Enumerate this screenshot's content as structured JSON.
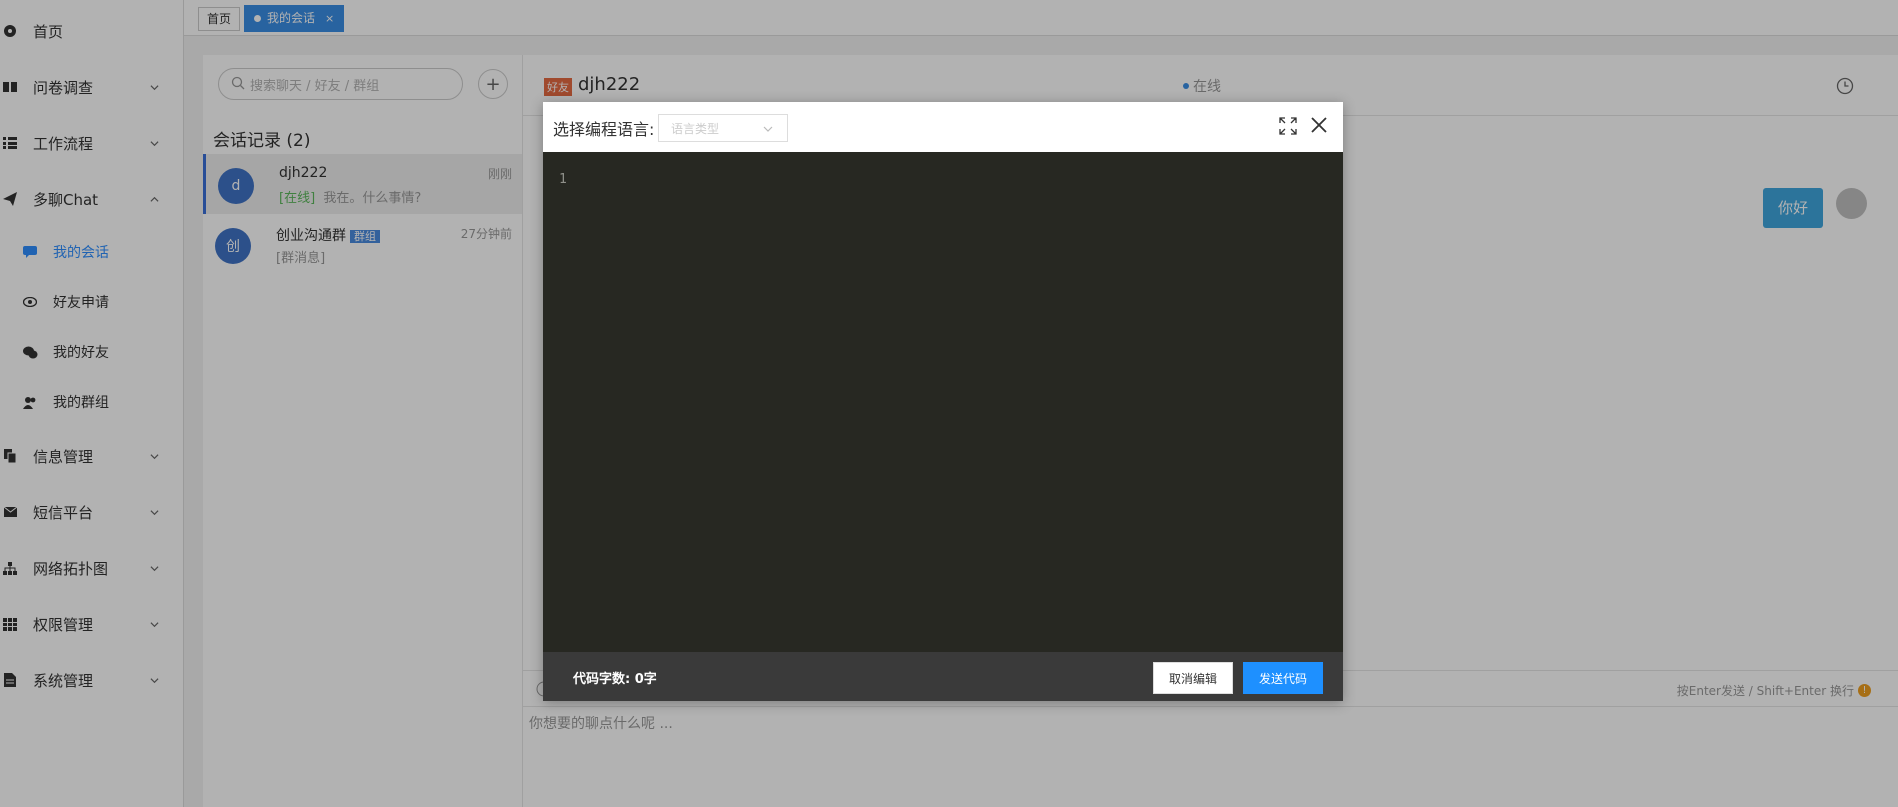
{
  "sidebar": {
    "menu": [
      {
        "label": "首页",
        "icon": "dashboard-icon"
      },
      {
        "label": "问卷调查",
        "icon": "book-icon"
      },
      {
        "label": "工作流程",
        "icon": "list-icon"
      },
      {
        "label": "多聊Chat",
        "icon": "paper-plane-icon"
      },
      {
        "label": "信息管理",
        "icon": "copy-icon"
      },
      {
        "label": "短信平台",
        "icon": "envelope-icon"
      },
      {
        "label": "网络拓扑图",
        "icon": "sitemap-icon"
      },
      {
        "label": "权限管理",
        "icon": "grid-icon"
      },
      {
        "label": "系统管理",
        "icon": "file-icon"
      }
    ],
    "chat_sub": [
      {
        "label": "我的会话",
        "icon": "comment-icon"
      },
      {
        "label": "好友申请",
        "icon": "eye-icon"
      },
      {
        "label": "我的好友",
        "icon": "wechat-icon"
      },
      {
        "label": "我的群组",
        "icon": "users-icon"
      }
    ]
  },
  "tabs": {
    "home": "首页",
    "active": "我的会话",
    "close": "×"
  },
  "conversations": {
    "search_placeholder": "搜索聊天 / 好友 / 群组",
    "add": "+",
    "title": "会话记录 (2)",
    "items": [
      {
        "avatar": "d",
        "name": "djh222",
        "status": "[在线]",
        "preview": "我在。什么事情?",
        "time": "刚刚"
      },
      {
        "avatar": "创",
        "name": "创业沟通群",
        "badge": "群组",
        "preview": "[群消息]",
        "time": "27分钟前"
      }
    ]
  },
  "chat": {
    "badge": "好友",
    "name": "djh222",
    "status": "在线",
    "message": "你好",
    "hint": "按Enter发送 / Shift+Enter 换行",
    "hint_icon": "!",
    "input_placeholder": "你想要的聊点什么呢 ..."
  },
  "modal": {
    "title": "选择编程语言:",
    "lang_placeholder": "语言类型",
    "line_number": "1",
    "char_count": "代码字数: 0字",
    "cancel": "取消编辑",
    "send": "发送代码"
  },
  "colors": {
    "accent": "#3a8ee6",
    "editor_bg": "#272822",
    "send_button": "#1e90ff",
    "friend_badge": "#e66a43"
  }
}
